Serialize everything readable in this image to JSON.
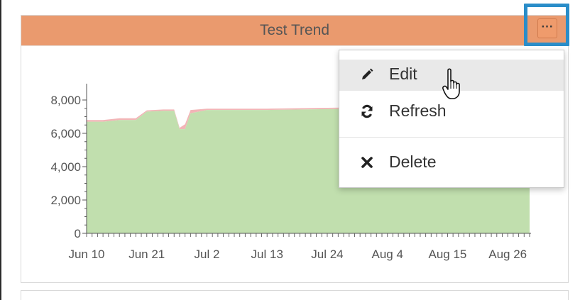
{
  "widget": {
    "title": "Test Trend",
    "header_color": "#ea9a6e",
    "more_button": {
      "label": "···",
      "icon": "ellipsis-icon"
    },
    "highlight_color": "#2a8dc9"
  },
  "menu": {
    "items": [
      {
        "label": "Edit",
        "icon": "pencil-icon"
      },
      {
        "label": "Refresh",
        "icon": "refresh-icon"
      },
      {
        "label": "Delete",
        "icon": "close-icon"
      }
    ]
  },
  "chart_data": {
    "type": "area",
    "title": "",
    "xlabel": "",
    "ylabel": "",
    "x_ticks": [
      "Jun 10",
      "Jun 21",
      "Jul 2",
      "Jul 13",
      "Jul 24",
      "Aug 4",
      "Aug 15",
      "Aug 26"
    ],
    "y_ticks": [
      "0",
      "2,000",
      "4,000",
      "6,000",
      "8,000"
    ],
    "ylim": [
      0,
      9000
    ],
    "x": [
      "Jun 10",
      "Jun 13",
      "Jun 16",
      "Jun 19",
      "Jun 21",
      "Jun 24",
      "Jun 26",
      "Jun 27",
      "Jun 28",
      "Jun 29",
      "Jul 2",
      "Jul 13",
      "Jul 24",
      "Aug 4",
      "Aug 15",
      "Aug 26",
      "Aug 30"
    ],
    "series": [
      {
        "color": "#c1dfae",
        "values": [
          6700,
          6700,
          6800,
          6800,
          7300,
          7350,
          7350,
          6250,
          6250,
          7200,
          7400,
          7400,
          7450,
          7500,
          7500,
          7500,
          7500
        ]
      },
      {
        "color": "#f2b5b7",
        "values": [
          100,
          100,
          100,
          100,
          80,
          80,
          80,
          80,
          300,
          200,
          80,
          80,
          80,
          80,
          80,
          80,
          80
        ]
      }
    ],
    "legend": "none",
    "grid": false
  }
}
